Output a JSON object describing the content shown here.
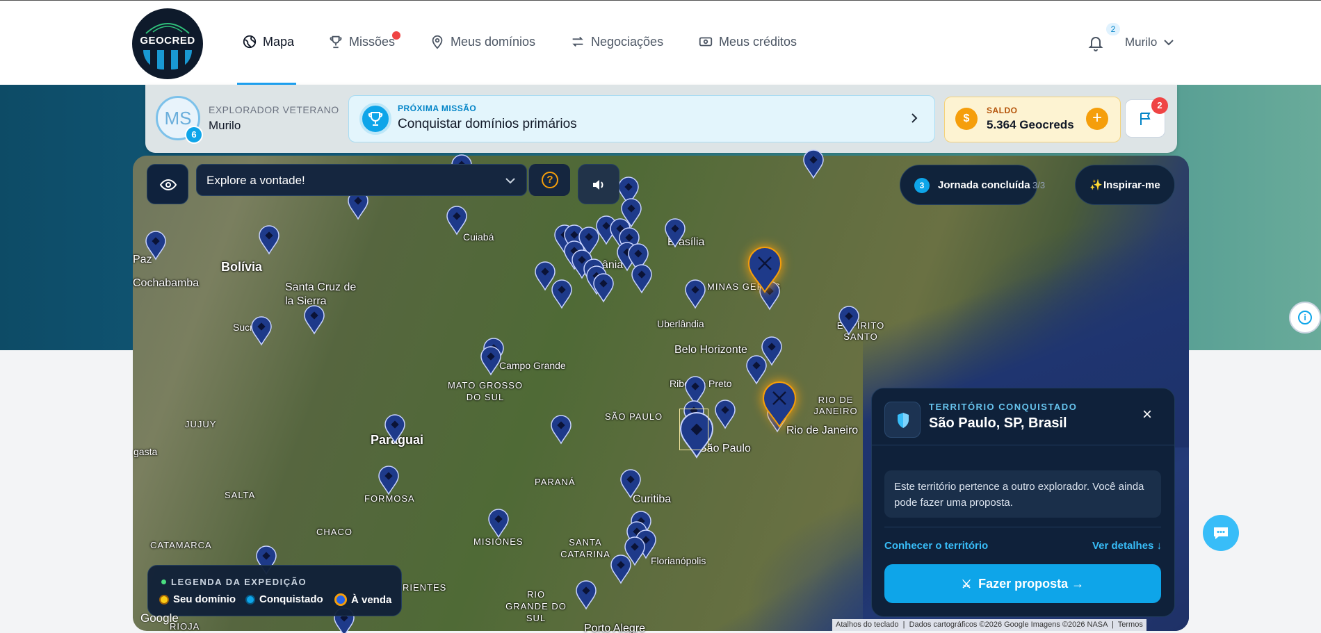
{
  "header": {
    "logo_text": "GEOCRED",
    "nav": [
      {
        "label": "Mapa",
        "icon": "globe-icon",
        "active": true
      },
      {
        "label": "Missões",
        "icon": "trophy-icon",
        "notification": true
      },
      {
        "label": "Meus domínios",
        "icon": "map-pin-icon"
      },
      {
        "label": "Negociações",
        "icon": "swap-arrows-icon"
      },
      {
        "label": "Meus créditos",
        "icon": "cash-icon"
      }
    ],
    "notifications_count": "2",
    "user_name": "Murilo"
  },
  "status_bar": {
    "avatar_initials": "MS",
    "level": "6",
    "rank": "EXPLORADOR VETERANO",
    "user_name": "Murilo",
    "mission_label": "PRÓXIMA MISSÃO",
    "mission_title": "Conquistar domínios primários",
    "balance_label": "SALDO",
    "balance_value": "5.364 Geocreds",
    "flags_count": "2"
  },
  "map": {
    "mode_select": "Explore a vontade!",
    "journey_count": "3",
    "journey_label": "Jornada concluída",
    "journey_progress": "3/3",
    "inspire_label": "Inspirar-me",
    "labels": {
      "bolivia": "Bolívia",
      "santa_cruz": "Santa Cruz de la Sierra",
      "cochabamba": "Cochabamba",
      "paz": "Paz",
      "sucre": "Sucre",
      "cuiaba": "Cuiabá",
      "brasilia": "Brasília",
      "minas_gerais": "MINAS GERAIS",
      "goiania": "ânia",
      "uberlandia": "Uberlândia",
      "belo_horizonte": "Belo Horizonte",
      "espirito_santo": "ESPÍRITO SANTO",
      "campo_grande": "Campo Grande",
      "mato_grosso_do_sul": "MATO GROSSO DO SUL",
      "ribeirao_preto": "Ribeirão Preto",
      "rio_de_janeiro_state": "RIO DE JANEIRO",
      "rio_de_janeiro": "Rio de Janeiro",
      "sao_paulo_state": "SÃO PAULO",
      "sao_paulo": "São Paulo",
      "jujuy": "JUJUY",
      "paraguai": "Paraguai",
      "gasta": "gasta",
      "parana": "PARANÁ",
      "curitiba": "Curitiba",
      "salta": "SALTA",
      "formosa": "FORMOSA",
      "chaco": "CHACO",
      "misiones": "MISIONES",
      "santa_catarina": "SANTA CATARINA",
      "florianopolis": "Florianópolis",
      "catamarca": "CATAMARCA",
      "rientes": "RIENTES",
      "rio_grande_do_sul": "RIO GRANDE DO SUL",
      "porto_alegre": "Porto Alegre",
      "rioja": "RIOJA"
    },
    "legend": {
      "title": "LEGENDA DA EXPEDIÇÃO",
      "items": [
        {
          "label": "Seu domínio",
          "color": "#facc15"
        },
        {
          "label": "Conquistado",
          "color": "#0ea5e9"
        },
        {
          "label": "À venda",
          "color": "#f59e0b"
        }
      ]
    },
    "google": "Google",
    "attribution": [
      "Atalhos do teclado",
      "Dados cartográficos ©2026 Google Imagens ©2026 NASA",
      "Termos"
    ]
  },
  "territory_panel": {
    "label": "TERRITÓRIO CONQUISTADO",
    "title": "São Paulo, SP, Brasil",
    "note": "Este território pertence a outro explorador. Você ainda pode fazer uma proposta.",
    "link_left": "Conhecer o território",
    "link_right": "Ver detalhes ↓",
    "button": "Fazer proposta →"
  },
  "colors": {
    "accent": "#0ea5e9",
    "pin": "#1e3a8a",
    "gold": "#f59e0b"
  }
}
